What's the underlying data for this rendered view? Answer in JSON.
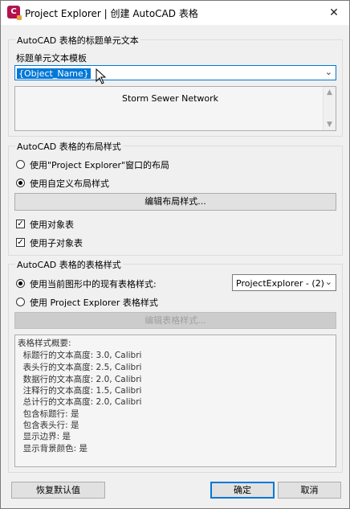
{
  "window": {
    "title": "Project Explorer | 创建 AutoCAD 表格",
    "app_icon_letter": "C",
    "close_glyph": "✕"
  },
  "title_section": {
    "group_label": "AutoCAD 表格的标题单元文本",
    "template_label": "标题单元文本模板",
    "template_value": "{Object_Name}",
    "preview_text": "Storm Sewer Network"
  },
  "layout_section": {
    "group_label": "AutoCAD 表格的布局样式",
    "radio_window_layout": "使用\"Project Explorer\"窗口的布局",
    "radio_custom_layout": "使用自定义布局样式",
    "selected": "custom",
    "edit_layout_button": "编辑布局样式...",
    "check_object_table": "使用对象表",
    "check_object_table_checked": true,
    "check_child_table": "使用子对象表",
    "check_child_table_checked": true
  },
  "table_style_section": {
    "group_label": "AutoCAD 表格的表格样式",
    "radio_current_drawing": "使用当前图形中的现有表格样式:",
    "radio_pe_style": "使用 Project Explorer 表格样式",
    "selected": "current_drawing",
    "style_dropdown_value": "ProjectExplorer - (2)",
    "edit_table_style_button": "编辑表格样式...",
    "summary_lines": [
      "表格样式概要:",
      "  标题行的文本高度: 3.0, Calibri",
      "  表头行的文本高度: 2.5, Calibri",
      "  数据行的文本高度: 2.0, Calibri",
      "  注释行的文本高度: 1.5, Calibri",
      "  总计行的文本高度: 2.0, Calibri",
      "  包含标题行: 是",
      "  包含表头行: 是",
      "  显示边界: 是",
      "  显示背景颜色: 是"
    ]
  },
  "footer": {
    "reset_button": "恢复默认值",
    "ok_button": "确定",
    "cancel_button": "取消"
  }
}
